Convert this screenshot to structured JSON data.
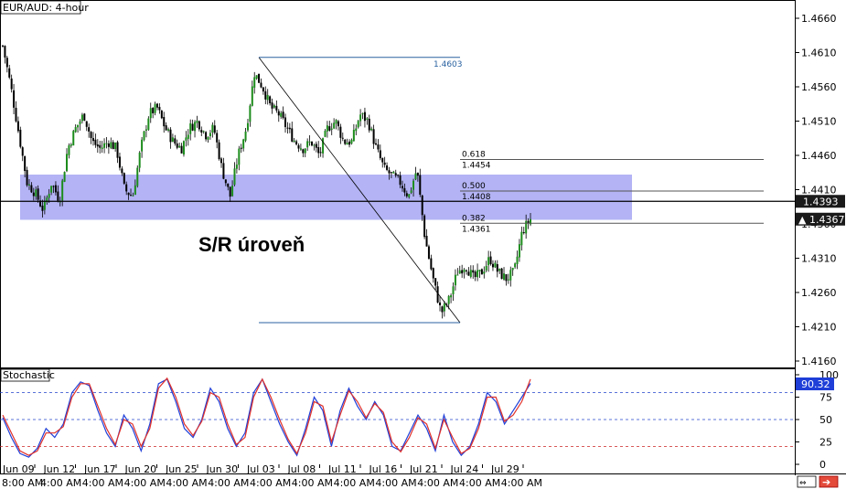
{
  "window": {
    "title": "EUR/AUD: 4-hour",
    "sub_panel_title": "Stochastic"
  },
  "annotation": {
    "sr_label": "S/R úroveň"
  },
  "colors": {
    "up_candle": "#1c8c1c",
    "down_candle": "#000000",
    "sr_zone": "#9999f2",
    "fib_line": "#555555",
    "high_line": "#2a62a0",
    "price_tag": "#1a1a1a",
    "stoch_blue": "#1f3fd8",
    "stoch_red": "#e0302a",
    "level_blue": "#2244cc",
    "level_red": "#cc2222"
  },
  "fib_levels": [
    {
      "ratio": "0.618",
      "price": "1.4454"
    },
    {
      "ratio": "0.500",
      "price": "1.4408"
    },
    {
      "ratio": "0.382",
      "price": "1.4361"
    }
  ],
  "swing": {
    "high_label": "1.4603",
    "high": 1.4603,
    "low": 1.4216
  },
  "price_tags": [
    {
      "value": "1.4393",
      "marker": ""
    },
    {
      "value": "1.4367",
      "marker": "▲"
    }
  ],
  "stoch_tag": "90.32",
  "chart_data": [
    {
      "type": "candlestick",
      "title": "EUR/AUD: 4-hour",
      "ylim": [
        1.413,
        1.468
      ],
      "y_ticks": [
        "1.4660",
        "1.4610",
        "1.4560",
        "1.4510",
        "1.4460",
        "1.4410",
        "1.4360",
        "1.4310",
        "1.4260",
        "1.4210",
        "1.4160"
      ],
      "x_labels": [
        "Jun 09",
        "Jun 12",
        "Jun 17",
        "Jun 20",
        "Jun 25",
        "Jun 30",
        "Jul 03",
        "Jul 08",
        "Jul 11",
        "Jul 16",
        "Jul 21",
        "Jul 24",
        "Jul 29"
      ],
      "time_labels": [
        "8:00 AM",
        "4:00 AM",
        "4:00 AM",
        "4:00 AM",
        "4:00 AM",
        "4:00 AM",
        "4:00 AM",
        "4:00 AM",
        "4:00 AM",
        "4:00 AM",
        "4:00 AM",
        "4:00 AM",
        "4:00 AM"
      ],
      "horizontal_line": 1.4393,
      "sr_zone": [
        1.4366,
        1.4432
      ],
      "close_path": [
        1.462,
        1.456,
        1.449,
        1.442,
        1.4405,
        1.438,
        1.442,
        1.4395,
        1.447,
        1.45,
        1.452,
        1.448,
        1.447,
        1.448,
        1.447,
        1.441,
        1.44,
        1.447,
        1.452,
        1.453,
        1.45,
        1.448,
        1.447,
        1.45,
        1.451,
        1.449,
        1.45,
        1.444,
        1.44,
        1.446,
        1.45,
        1.458,
        1.456,
        1.453,
        1.452,
        1.45,
        1.448,
        1.447,
        1.448,
        1.446,
        1.45,
        1.451,
        1.448,
        1.448,
        1.452,
        1.451,
        1.447,
        1.444,
        1.443,
        1.442,
        1.44,
        1.444,
        1.434,
        1.428,
        1.423,
        1.425,
        1.429,
        1.43,
        1.428,
        1.429,
        1.431,
        1.429,
        1.428,
        1.429,
        1.435,
        1.4367
      ]
    },
    {
      "type": "line",
      "title": "Stochastic",
      "ylim": [
        0,
        100
      ],
      "y_ticks": [
        "100",
        "75",
        "50",
        "25",
        "0"
      ],
      "levels": [
        80,
        50,
        20
      ],
      "series": [
        {
          "color": "#1f3fd8",
          "values": [
            52,
            30,
            12,
            8,
            18,
            40,
            30,
            45,
            80,
            92,
            88,
            60,
            35,
            20,
            55,
            40,
            15,
            45,
            90,
            95,
            70,
            40,
            30,
            50,
            85,
            70,
            40,
            20,
            35,
            80,
            95,
            70,
            45,
            25,
            10,
            40,
            75,
            60,
            20,
            60,
            85,
            65,
            50,
            70,
            55,
            20,
            15,
            35,
            55,
            40,
            15,
            55,
            25,
            10,
            20,
            45,
            80,
            70,
            45,
            60,
            75,
            90.32
          ]
        },
        {
          "color": "#e0302a",
          "values": [
            55,
            35,
            15,
            10,
            15,
            35,
            35,
            42,
            75,
            90,
            90,
            65,
            40,
            22,
            50,
            45,
            20,
            40,
            85,
            96,
            75,
            45,
            32,
            48,
            80,
            75,
            45,
            22,
            30,
            75,
            95,
            75,
            50,
            28,
            12,
            35,
            70,
            65,
            25,
            55,
            82,
            70,
            52,
            68,
            58,
            25,
            14,
            30,
            52,
            45,
            18,
            50,
            30,
            12,
            18,
            40,
            75,
            75,
            48,
            55,
            70,
            95
          ]
        }
      ]
    }
  ]
}
